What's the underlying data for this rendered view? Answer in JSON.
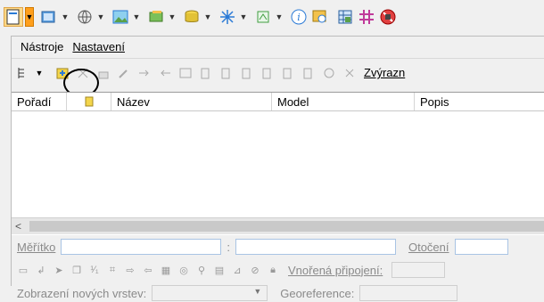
{
  "toolbar_top": {
    "icons": [
      "new-document-icon",
      "layers-icon",
      "globe-icon",
      "image-icon",
      "library-icon",
      "database-icon",
      "sparkle-icon",
      "tools-icon",
      "info-icon",
      "search-icon",
      "table-icon",
      "grid-icon",
      "block-icon"
    ]
  },
  "menu": {
    "items": [
      {
        "label": "Nástroje"
      },
      {
        "label": "Nastavení"
      }
    ]
  },
  "toolbar2": {
    "highlight_label": "Zvýrazn"
  },
  "grid": {
    "columns": [
      "Pořadí",
      "",
      "Název",
      "Model",
      "Popis"
    ]
  },
  "status": {
    "scale_label": "Měřítko",
    "separator": ":",
    "rotation_label": "Otočení",
    "nested_label": "Vnořená připojení:",
    "new_layers_label": "Zobrazení nových vrstev:",
    "georef_label": "Georeference:"
  },
  "colors": {
    "accent": "#ff9f1c",
    "field_border": "#a9c4e4"
  }
}
